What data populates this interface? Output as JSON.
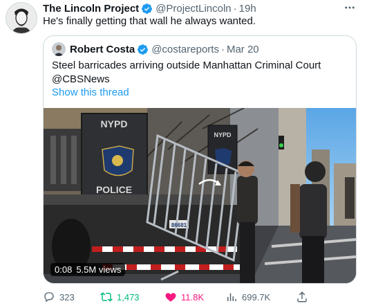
{
  "tweet": {
    "author_name": "The Lincoln Project",
    "author_handle": "@ProjectLincoln",
    "separator": "·",
    "time": "19h",
    "text": "He's finally getting that wall he always wanted."
  },
  "quoted": {
    "author_name": "Robert Costa",
    "author_handle": "@costareports",
    "separator": "·",
    "time": "Mar 20",
    "text_line1": "Steel barricades arriving outside  Manhattan Criminal Court",
    "text_line2": "@CBSNews",
    "show_thread": "Show this thread",
    "video": {
      "duration": "0:08",
      "views": "5.5M views",
      "sign_nypd_truck": "NYPD",
      "sign_police": "POLICE",
      "sign_nypd_barrier": "NYPD",
      "plate": "86681"
    }
  },
  "actions": {
    "reply_count": "323",
    "retweet_count": "1,473",
    "like_count": "11.8K",
    "view_count": "699.7K"
  },
  "colors": {
    "verified_blue": "#1d9bf0",
    "retweet_green": "#00ba7c",
    "like_pink": "#f91880",
    "secondary_gray": "#536471"
  },
  "icons": [
    "verified-badge-icon",
    "more-icon",
    "reply-icon",
    "retweet-icon",
    "heart-icon",
    "views-icon",
    "share-icon"
  ]
}
